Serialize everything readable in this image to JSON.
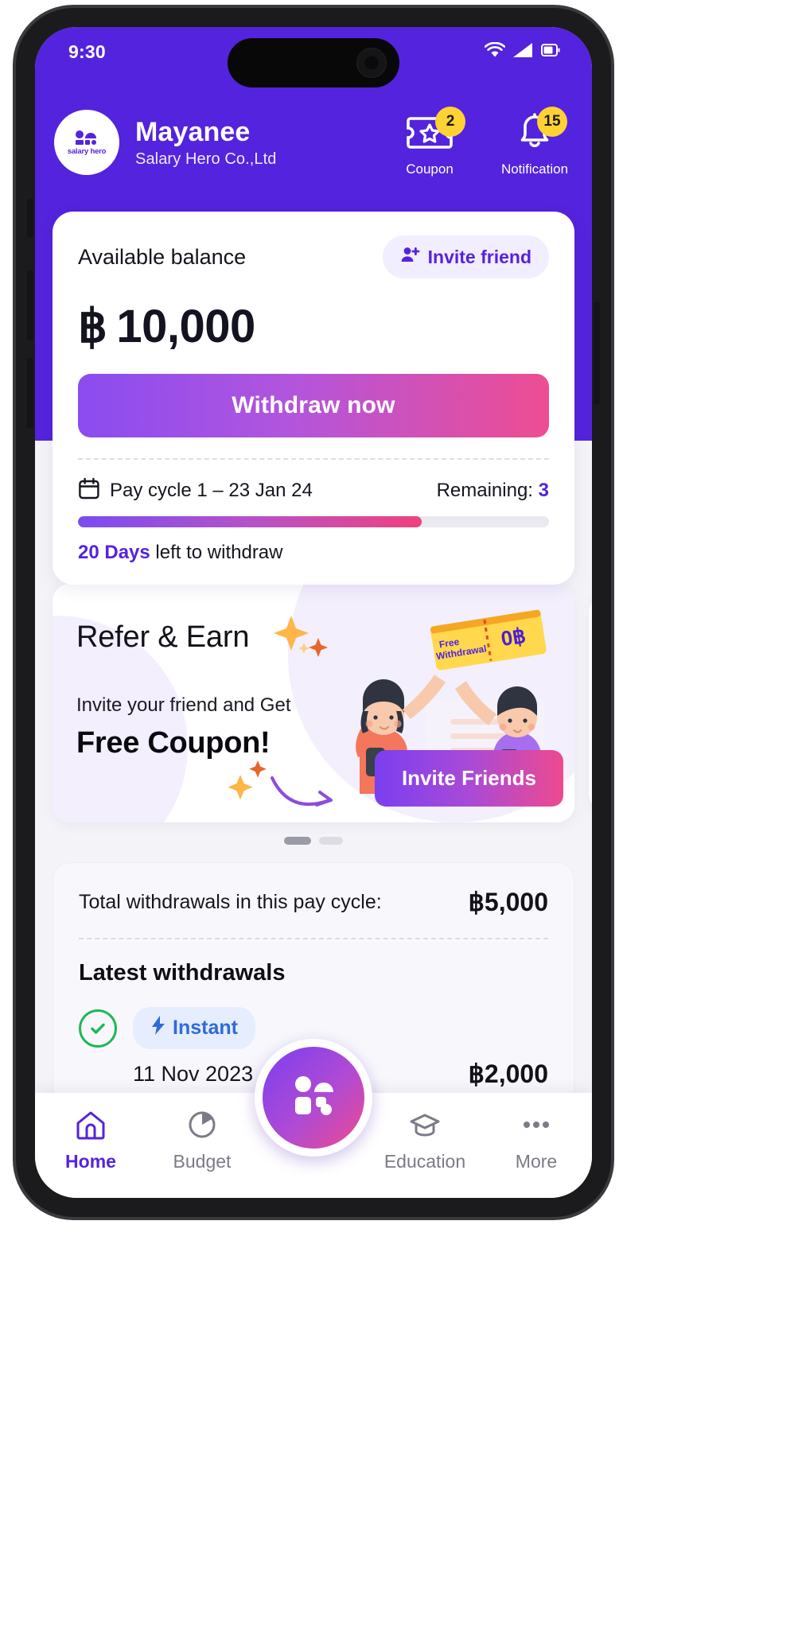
{
  "status_bar": {
    "time": "9:30",
    "icons": [
      "wifi-icon",
      "cellular-signal-icon",
      "battery-icon"
    ]
  },
  "header": {
    "logo_text": "salary hero",
    "user_name": "Mayanee",
    "company_name": "Salary Hero Co.,Ltd",
    "actions": [
      {
        "icon": "coupon-ticket-icon",
        "label": "Coupon",
        "badge": "2"
      },
      {
        "icon": "bell-notification-icon",
        "label": "Notification",
        "badge": "15"
      }
    ]
  },
  "balance_card": {
    "label": "Available balance",
    "invite_button": "Invite friend",
    "invite_icon": "person-add-icon",
    "currency_symbol": "฿",
    "amount": "10,000",
    "withdraw_button": "Withdraw now",
    "calendar_icon": "calendar-icon",
    "pay_cycle": "Pay cycle 1 – 23 Jan 24",
    "remaining_label": "Remaining:",
    "remaining_count": "3",
    "progress_percent": 73,
    "days_left_count": "20 Days",
    "days_left_rest": " left to withdraw"
  },
  "banner": {
    "title": "Refer & Earn",
    "subtitle": "Invite your friend and Get",
    "highlight": "Free Coupon!",
    "cta": "Invite Friends",
    "coupon_art_line1": "Free",
    "coupon_art_line2": "Withdrawal",
    "coupon_art_value": "0฿",
    "dots": [
      {
        "state": "active"
      },
      {
        "state": "inactive"
      }
    ]
  },
  "withdrawals": {
    "total_label": "Total withdrawals in this pay cycle:",
    "total_value": "฿5,000",
    "latest_title": "Latest withdrawals",
    "rows": [
      {
        "status_icon": "check-circle-icon",
        "type_icon": "lightning-bolt-icon",
        "type": "Instant",
        "date": "11 Nov 2023",
        "amount": "฿2,000"
      }
    ]
  },
  "bottom_nav": {
    "items": [
      {
        "icon": "home-icon",
        "label": "Home",
        "active": true
      },
      {
        "icon": "pie-chart-icon",
        "label": "Budget",
        "active": false
      },
      {
        "icon": "graduation-cap-icon",
        "label": "Education",
        "active": false
      },
      {
        "icon": "more-dots-icon",
        "label": "More",
        "active": false
      }
    ],
    "fab_icon": "salary-hero-logo-icon"
  },
  "colors": {
    "brand_purple": "#5423dd",
    "gradient_start": "#7b3ff0",
    "gradient_end": "#ee4a8e",
    "badge_yellow": "#ffd233",
    "success_green": "#1db954",
    "instant_blue": "#2f6bd8"
  }
}
